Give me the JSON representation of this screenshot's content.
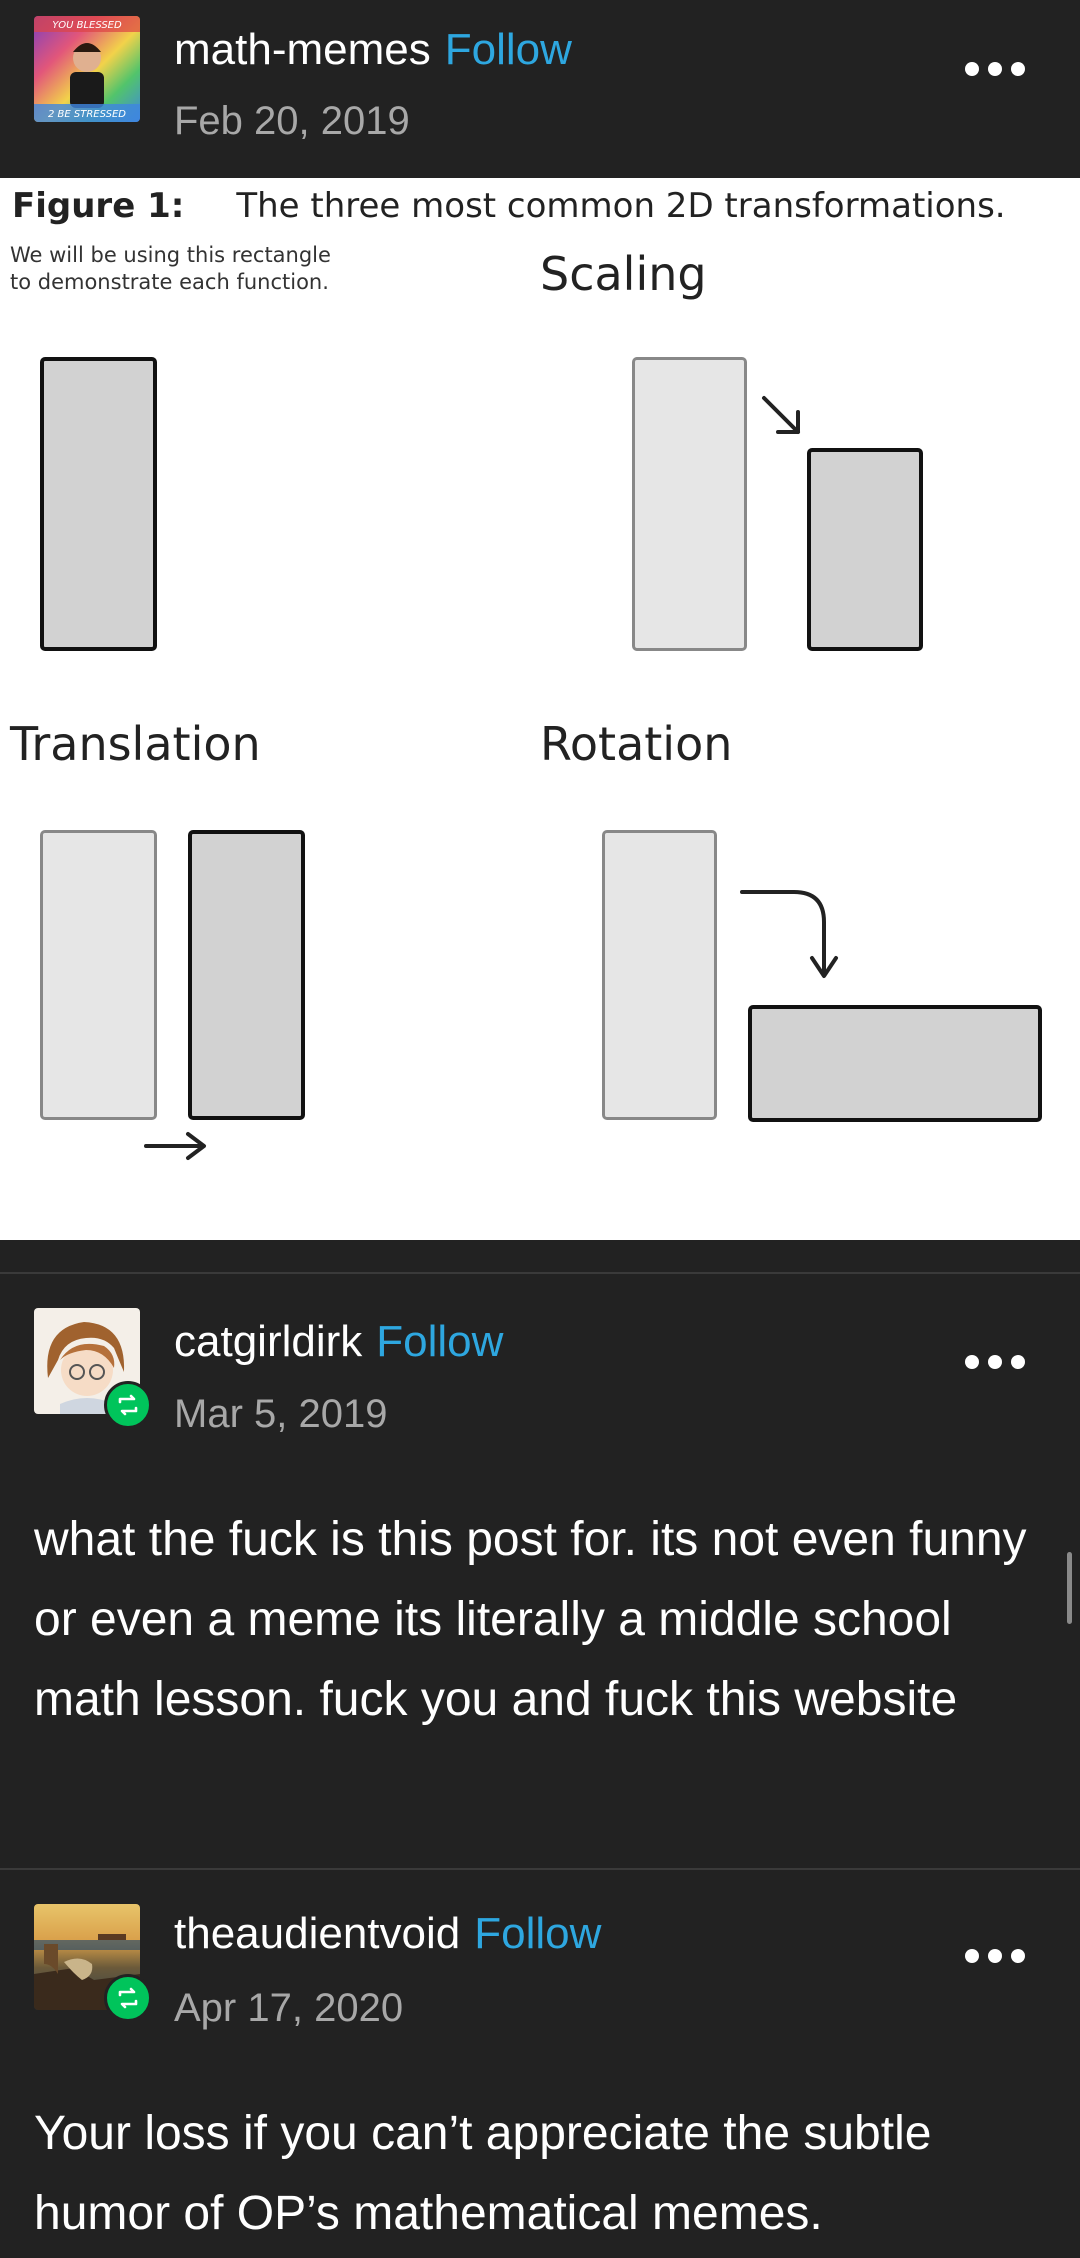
{
  "posts": [
    {
      "username": "math-memes",
      "follow_label": "Follow",
      "date": "Feb 20, 2019",
      "avatar_text_top": "YOU BLESSED",
      "avatar_text_bottom": "2 BE STRESSED"
    },
    {
      "username": "catgirldirk",
      "follow_label": "Follow",
      "date": "Mar 5, 2019",
      "body": "what the fuck is this post for. its not even funny or even a meme its literally a middle school math lesson. fuck you and fuck this website"
    },
    {
      "username": "theaudientvoid",
      "follow_label": "Follow",
      "date": "Apr 17, 2020",
      "body": "Your loss if you can’t appreciate the subtle humor of OP’s mathematical memes."
    }
  ],
  "figure": {
    "label": "Figure 1:",
    "caption": "The three most common 2D transformations.",
    "note_line1": "We will be using this rectangle",
    "note_line2": "to demonstrate each function.",
    "scaling": "Scaling",
    "translation": "Translation",
    "rotation": "Rotation"
  },
  "icons": {
    "more": "more-options-icon",
    "reblog": "reblog-icon"
  },
  "colors": {
    "background": "#222222",
    "follow": "#2ea7e0",
    "reblog_badge": "#00c45b",
    "date": "#a8a8a8"
  }
}
